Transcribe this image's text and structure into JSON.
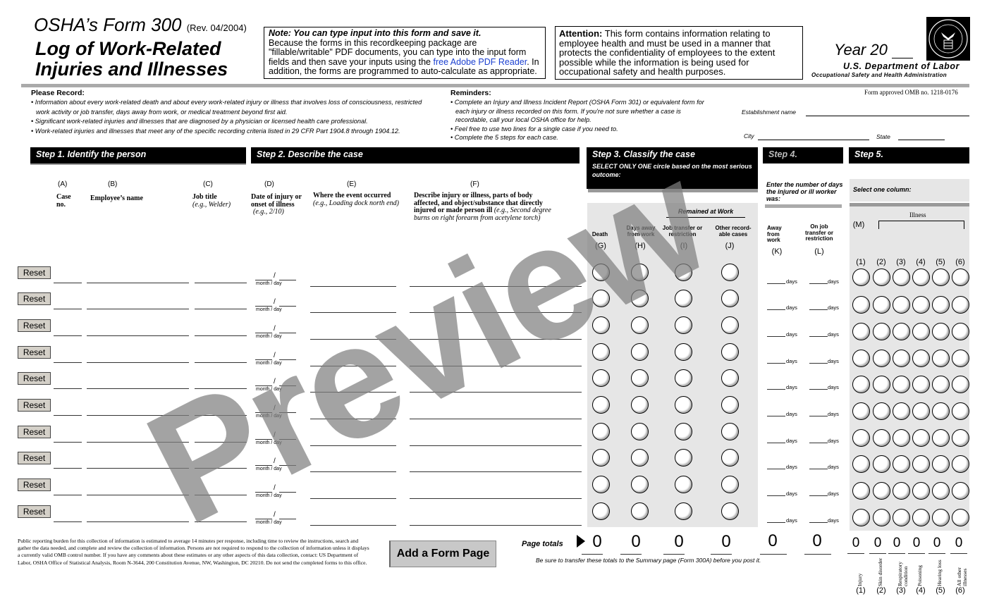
{
  "header": {
    "form_title": "OSHA’s Form 300",
    "revision": "(Rev. 04/2004)",
    "log_title_line1": "Log of Work-Related",
    "log_title_line2": "Injuries and Illnesses",
    "note_heading": "Note: You can type input into this form and save it.",
    "note_body_1": "Because the forms in this recordkeeping package are \"fillable/writable\" PDF documents, you can type into the input form fields and then save your inputs using the ",
    "note_link": "free Adobe PDF Reader",
    "note_body_2": ". In addition, the forms are programmed to auto-calculate as appropriate.",
    "attention_label": "Attention:",
    "attention_body": " This form contains information relating to employee health and must be used in a manner that protects the confidentiality of employees to the extent possible while the information is being used for occupational safety and health purposes.",
    "year_label": "Year 20",
    "agency": "U.S. Department of Labor",
    "sub_agency": "Occupational Safety and Health Administration",
    "seal_icon": "dol-seal-icon",
    "omb": "Form approved OMB no. 1218-0176"
  },
  "please_record": {
    "title": "Please Record:",
    "items": [
      "• Information about every work-related death and about every work-related injury or illness that involves loss of consciousness, restricted work activity or job transfer, days away from work, or medical treatment beyond first aid.",
      "• Significant work-related injuries and illnesses that are diagnosed by a physician or licensed health care professional.",
      "• Work-related injuries and illnesses that meet any of the specific recording criteria listed in 29 CFR Part 1904.8 through 1904.12."
    ]
  },
  "reminders": {
    "title": "Reminders:",
    "items": [
      "• Complete an Injury and Illness Incident Report (OSHA Form 301) or equivalent form for each injury or illness recorded on this form. If you're not sure whether a case is recordable, call your local OSHA office for help.",
      "• Feel free to use two lines for a single case if you need to.",
      "• Complete the 5 steps for each case."
    ]
  },
  "establishment": {
    "name_label": "Establishment name",
    "name_value": "",
    "city_label": "City",
    "city_value": "",
    "state_label": "State",
    "state_value": ""
  },
  "steps": {
    "step1": "Step 1. Identify the person",
    "step2": "Step 2. Describe the case",
    "step3": "Step 3. Classify the case",
    "step3_sub": "SELECT ONLY ONE circle based on the most serious outcome:",
    "step4": "Step 4.",
    "step4_sub": "Enter the number of days the injured or ill worker was:",
    "step5": "Step 5.",
    "step5_sub": "Select one column:"
  },
  "columns": {
    "A": {
      "letter": "(A)",
      "title": "Case no.",
      "example": ""
    },
    "B": {
      "letter": "(B)",
      "title": "Employee’s name",
      "example": ""
    },
    "C": {
      "letter": "(C)",
      "title": "Job title",
      "example": "(e.g., Welder)"
    },
    "D": {
      "letter": "(D)",
      "title": "Date of injury or onset of illness",
      "example": "(e.g., 2/10)"
    },
    "E": {
      "letter": "(E)",
      "title": "Where the event occurred",
      "example": "(e.g., Loading dock north end)"
    },
    "F": {
      "letter": "(F)",
      "title": "Describe injury or illness, parts of body affected, and object/substance that directly injured or made person ill",
      "example": "(e.g., Second degree burns on right forearm from acetylene torch)"
    },
    "remained_at_work": "Remained at Work",
    "G": {
      "letter": "(G)",
      "title": "Death"
    },
    "H": {
      "letter": "(H)",
      "title": "Days away from work"
    },
    "I": {
      "letter": "(I)",
      "title": "Job transfer or restriction"
    },
    "J": {
      "letter": "(J)",
      "title": "Other record-able cases"
    },
    "K": {
      "letter": "(K)",
      "title": "Away from work"
    },
    "L": {
      "letter": "(L)",
      "title": "On job transfer or restriction"
    },
    "M": {
      "letter": "(M)",
      "illness_label": "Illness"
    },
    "M_types": [
      {
        "num": "(1)",
        "name": "Injury"
      },
      {
        "num": "(2)",
        "name": "Skin disorder"
      },
      {
        "num": "(3)",
        "name": "Respiratory condition"
      },
      {
        "num": "(4)",
        "name": "Poisoning"
      },
      {
        "num": "(5)",
        "name": "Hearing loss"
      },
      {
        "num": "(6)",
        "name": "All other illnesses"
      }
    ]
  },
  "rows": {
    "reset_label": "Reset",
    "date_hint": "month / day",
    "date_sep": "/",
    "days_label": "days",
    "count": 10,
    "entries": [
      {
        "case_no": "",
        "name": "",
        "job": "",
        "month": "",
        "day": "",
        "where": "",
        "describe": "",
        "away_days": "",
        "transfer_days": "",
        "classification": null,
        "type": null
      },
      {
        "case_no": "",
        "name": "",
        "job": "",
        "month": "",
        "day": "",
        "where": "",
        "describe": "",
        "away_days": "",
        "transfer_days": "",
        "classification": null,
        "type": null
      },
      {
        "case_no": "",
        "name": "",
        "job": "",
        "month": "",
        "day": "",
        "where": "",
        "describe": "",
        "away_days": "",
        "transfer_days": "",
        "classification": null,
        "type": null
      },
      {
        "case_no": "",
        "name": "",
        "job": "",
        "month": "",
        "day": "",
        "where": "",
        "describe": "",
        "away_days": "",
        "transfer_days": "",
        "classification": null,
        "type": null
      },
      {
        "case_no": "",
        "name": "",
        "job": "",
        "month": "",
        "day": "",
        "where": "",
        "describe": "",
        "away_days": "",
        "transfer_days": "",
        "classification": null,
        "type": null
      },
      {
        "case_no": "",
        "name": "",
        "job": "",
        "month": "",
        "day": "",
        "where": "",
        "describe": "",
        "away_days": "",
        "transfer_days": "",
        "classification": null,
        "type": null
      },
      {
        "case_no": "",
        "name": "",
        "job": "",
        "month": "",
        "day": "",
        "where": "",
        "describe": "",
        "away_days": "",
        "transfer_days": "",
        "classification": null,
        "type": null
      },
      {
        "case_no": "",
        "name": "",
        "job": "",
        "month": "",
        "day": "",
        "where": "",
        "describe": "",
        "away_days": "",
        "transfer_days": "",
        "classification": null,
        "type": null
      },
      {
        "case_no": "",
        "name": "",
        "job": "",
        "month": "",
        "day": "",
        "where": "",
        "describe": "",
        "away_days": "",
        "transfer_days": "",
        "classification": null,
        "type": null
      },
      {
        "case_no": "",
        "name": "",
        "job": "",
        "month": "",
        "day": "",
        "where": "",
        "describe": "",
        "away_days": "",
        "transfer_days": "",
        "classification": null,
        "type": null
      }
    ]
  },
  "footer": {
    "burden": "Public reporting burden for this collection of information is estimated to average 14 minutes per response, including time to review the instructions, search and gather the data needed, and complete and review the collection of information. Persons are not required to respond to the collection of information unless it displays a currently valid OMB control number. If you have any comments about these estimates or any other aspects of this data collection, contact: US Department of Labor, OSHA Office of Statistical Analysis, Room N-3644, 200 Constitution Avenue, NW, Washington, DC 20210. Do not send the completed forms to this office.",
    "add_page_button": "Add a Form Page",
    "page_totals_label": "Page totals",
    "totals_GJ": [
      "0",
      "0",
      "0",
      "0"
    ],
    "totals_KL": [
      "0",
      "0"
    ],
    "totals_M": [
      "0",
      "0",
      "0",
      "0",
      "0",
      "0"
    ],
    "transfer_note": "Be sure to transfer these totals to the Summary page (Form 300A) before you post it."
  },
  "watermark": "Preview"
}
